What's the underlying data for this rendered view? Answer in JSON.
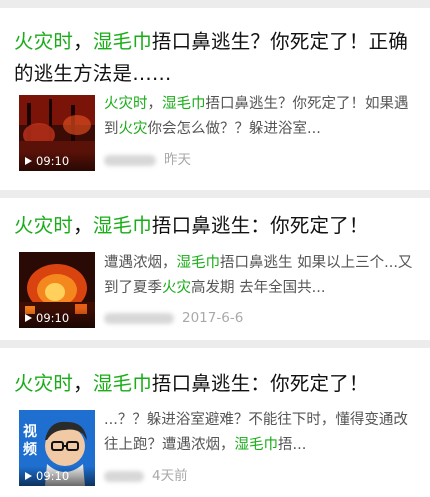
{
  "feed": {
    "items": [
      {
        "title_parts": [
          "火灾时",
          "，",
          "湿毛巾",
          "捂口鼻逃生？你死定了！正确的逃生方法是……"
        ],
        "snippet_parts": [
          "火灾时",
          "，",
          "湿毛巾",
          "捂口鼻逃生？你死定了！如果遇到",
          "火灾",
          "你会怎么做？？躲进浴室..."
        ],
        "duration": "09:10",
        "date": "昨天",
        "thumb_icon": "fire-scene-thumbnail"
      },
      {
        "title_parts": [
          "火灾时",
          "，",
          "湿毛巾",
          "捂口鼻逃生：你死定了！"
        ],
        "snippet_parts": [
          "遭遇浓烟，",
          "湿毛巾",
          "捂口鼻逃生 如果以上三个...又到了夏季",
          "火灾",
          "高发期 去年全国共..."
        ],
        "duration": "09:10",
        "date": "2017-6-6",
        "thumb_icon": "burning-building-thumbnail"
      },
      {
        "title_parts": [
          "火灾时",
          "，",
          "湿毛巾",
          "捂口鼻逃生：你死定了！"
        ],
        "snippet_parts": [
          "...？？躲进浴室避难？不能往下时，懂得变通改往上跑？遭遇浓烟，",
          "湿毛巾",
          "捂..."
        ],
        "duration": "09:10",
        "date": "4天前",
        "thumb_icon": "cartoon-avatar-thumbnail",
        "thumb_text": "视\n频"
      }
    ]
  },
  "colors": {
    "highlight": "#1aad19",
    "background": "#ececec"
  }
}
